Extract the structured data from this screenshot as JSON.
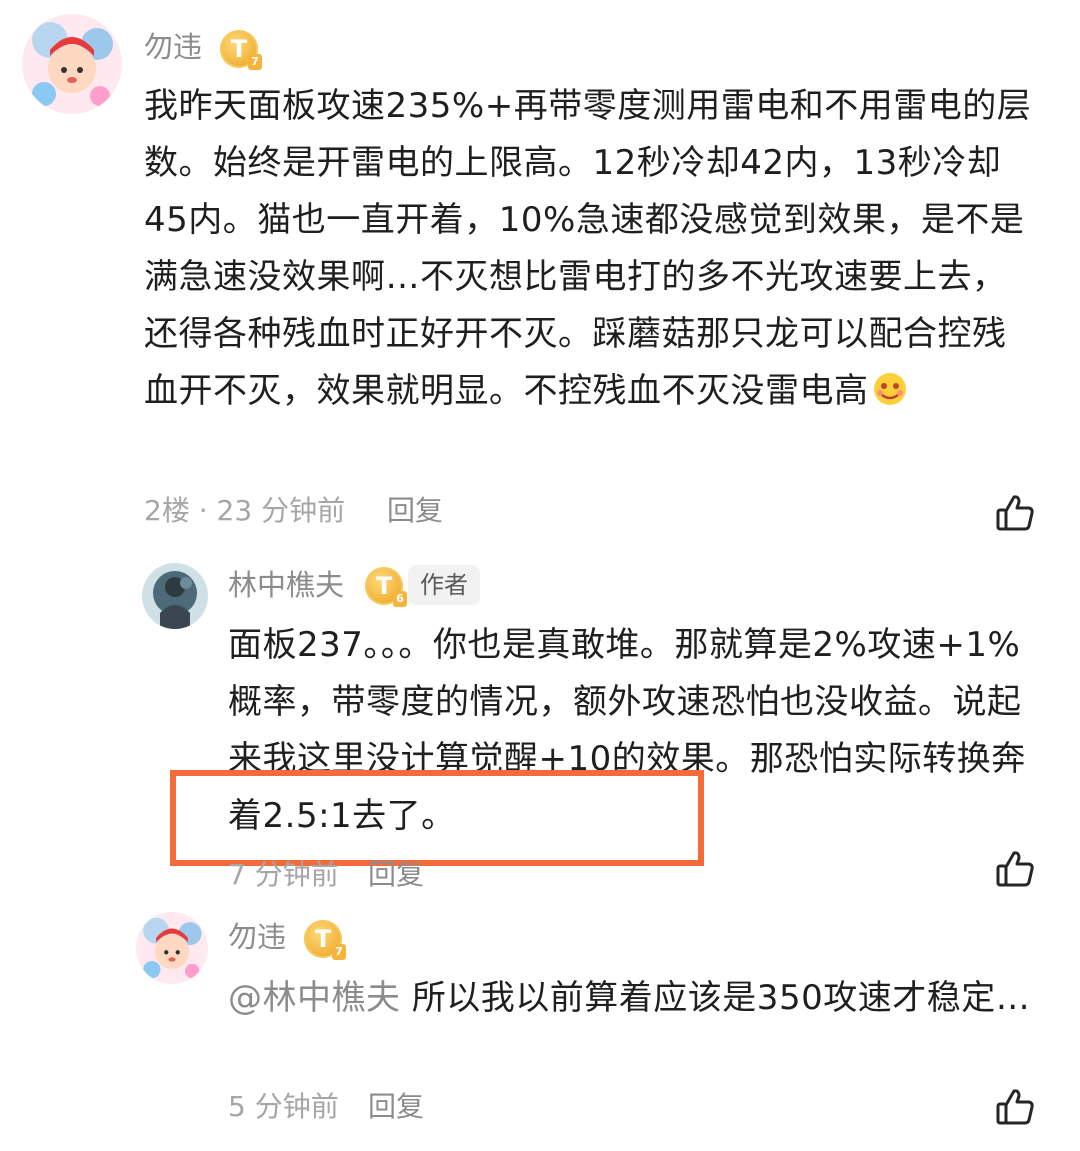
{
  "comments": [
    {
      "user": "勿违",
      "level": "T",
      "level_sub": "7",
      "content": "我昨天面板攻速235%+再带零度测用雷电和不用雷电的层数。始终是开雷电的上限高。12秒冷却42内，13秒冷却45内。猫也一直开着，10%急速都没感觉到效果，是不是满急速没效果啊…不灭想比雷电打的多不光攻速要上去，还得各种残血时正好开不灭。踩蘑菇那只龙可以配合控残血开不灭，效果就明显。不控残血不灭没雷电高",
      "floor": "2楼",
      "time": "23 分钟前",
      "reply_label": "回复"
    },
    {
      "user": "林中樵夫",
      "level": "T",
      "level_sub": "6",
      "badge": "作者",
      "content": "面板237。。。你也是真敢堆。那就算是2%攻速+1%概率，带零度的情况，额外攻速恐怕也没收益。说起来我这里没计算觉醒+10的效果。那恐怕实际转换奔着2.5:1去了。",
      "time": "7 分钟前",
      "reply_label": "回复"
    },
    {
      "user": "勿违",
      "level": "T",
      "level_sub": "7",
      "mention": "@林中樵夫",
      "content": "所以我以前算着应该是350攻速才稳定…",
      "time": "5 分钟前",
      "reply_label": "回复"
    }
  ],
  "colors": {
    "highlight": "#f36b3a",
    "level_gold": "#f2b640"
  }
}
